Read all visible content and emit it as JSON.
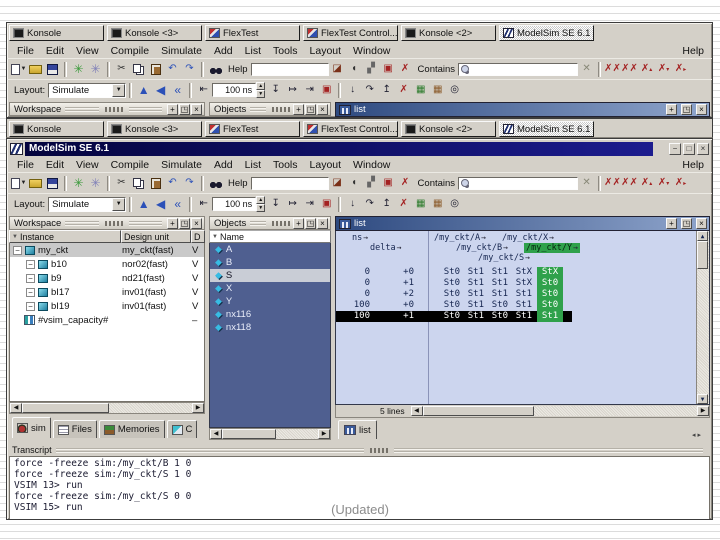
{
  "slide": {
    "note": "(Updated)"
  },
  "colors": {
    "titlebar_navy": "#000080",
    "window_grey": "#d4d0c8",
    "objects_bg": "#4f5f90",
    "list_bg": "#ccd5ee",
    "highlight_green": "#2fa14b",
    "selected_row_black": "#000000",
    "diamond_cyan": "#38bce4"
  },
  "taskbar": {
    "tabs": [
      {
        "label": "Konsole",
        "icon": "konsole-icon",
        "active": false
      },
      {
        "label": "Konsole <3>",
        "icon": "konsole-icon",
        "active": false
      },
      {
        "label": "FlexTest",
        "icon": "flextest-icon",
        "active": false
      },
      {
        "label": "FlexTest Control...",
        "icon": "flextest-icon",
        "active": false
      },
      {
        "label": "Konsole <2>",
        "icon": "konsole-icon",
        "active": false
      },
      {
        "label": "ModelSim SE 6.1",
        "icon": "modelsim-icon",
        "active": true
      }
    ]
  },
  "window": {
    "title": "ModelSim SE 6.1",
    "menus": [
      "File",
      "Edit",
      "View",
      "Compile",
      "Simulate",
      "Add",
      "List",
      "Tools",
      "Layout",
      "Window"
    ],
    "help_menu": "Help",
    "toolbars": {
      "help_label": "Help",
      "help_value": "",
      "contains_label": "Contains",
      "contains_value": "",
      "layout_label": "Layout:",
      "layout_value": "Simulate",
      "run_length": "100 ns"
    }
  },
  "workspace": {
    "title": "Workspace",
    "columns": [
      "Instance",
      "Design unit",
      "D"
    ],
    "rows": [
      {
        "instance": "my_ckt",
        "design_unit": "my_ckt(fast)",
        "type": "V",
        "selected": true
      },
      {
        "instance": "b10",
        "design_unit": "nor02(fast)",
        "type": "V",
        "selected": false
      },
      {
        "instance": "b9",
        "design_unit": "nd21(fast)",
        "type": "V",
        "selected": false
      },
      {
        "instance": "bI17",
        "design_unit": "inv01(fast)",
        "type": "V",
        "selected": false
      },
      {
        "instance": "bI19",
        "design_unit": "inv01(fast)",
        "type": "V",
        "selected": false
      },
      {
        "instance": "#vsim_capacity#",
        "design_unit": "",
        "type": "–",
        "selected": false
      }
    ],
    "tabs": [
      "sim",
      "Files",
      "Memories",
      "C"
    ]
  },
  "objects": {
    "title": "Objects",
    "column": "Name",
    "items": [
      {
        "name": "A",
        "selected": false
      },
      {
        "name": "B",
        "selected": false
      },
      {
        "name": "S",
        "selected": true
      },
      {
        "name": "X",
        "selected": false
      },
      {
        "name": "Y",
        "selected": false
      },
      {
        "name": "nx116",
        "selected": false
      },
      {
        "name": "nx118",
        "selected": false
      }
    ]
  },
  "list": {
    "title": "list",
    "tab": "list",
    "time_header": "ns",
    "delta_header": "delta",
    "signals": [
      "/my_ckt/A",
      "/my_ckt/B",
      "/my_ckt/S",
      "/my_ckt/X",
      "/my_ckt/Y"
    ],
    "highlight_signal": "/my_ckt/Y",
    "rows": [
      {
        "ns": "0",
        "delta": "+0",
        "values": [
          "St0",
          "St1",
          "St1",
          "StX",
          "StX"
        ],
        "selected": false
      },
      {
        "ns": "0",
        "delta": "+1",
        "values": [
          "St0",
          "St1",
          "St1",
          "StX",
          "St0"
        ],
        "selected": false
      },
      {
        "ns": "0",
        "delta": "+2",
        "values": [
          "St0",
          "St1",
          "St1",
          "St1",
          "St0"
        ],
        "selected": false
      },
      {
        "ns": "100",
        "delta": "+0",
        "values": [
          "St0",
          "St1",
          "St0",
          "St1",
          "St0"
        ],
        "selected": false
      },
      {
        "ns": "100",
        "delta": "+1",
        "values": [
          "St0",
          "St1",
          "St0",
          "St1",
          "St1"
        ],
        "selected": true
      }
    ],
    "status": "5 lines"
  },
  "transcript": {
    "title": "Transcript",
    "lines": [
      "force -freeze sim:/my_ckt/B 1 0",
      "force -freeze sim:/my_ckt/S 1 0",
      "VSIM 13> run",
      "force -freeze sim:/my_ckt/S 0 0",
      "VSIM 15> run"
    ]
  }
}
